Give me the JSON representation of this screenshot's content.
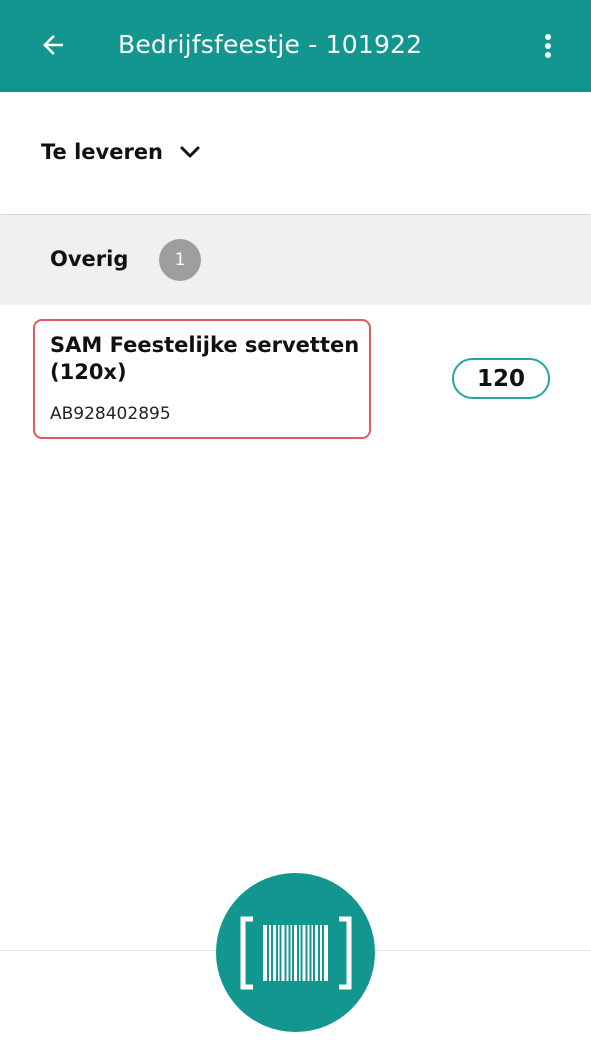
{
  "appbar": {
    "title": "Bedrijfsfeestje - 101922",
    "back_icon": "arrow-back-icon",
    "menu_icon": "more-vert-icon",
    "color": "#13968f"
  },
  "filter": {
    "selected": "Te leveren",
    "icon": "chevron-down-icon"
  },
  "section": {
    "title": "Overig",
    "count": "1"
  },
  "items": [
    {
      "name": "SAM Feestelijke servetten (120x)",
      "code": "AB928402895",
      "quantity": "120",
      "highlight_color": "#e05a60"
    }
  ],
  "scan_button": {
    "icon": "barcode-scan-icon"
  }
}
